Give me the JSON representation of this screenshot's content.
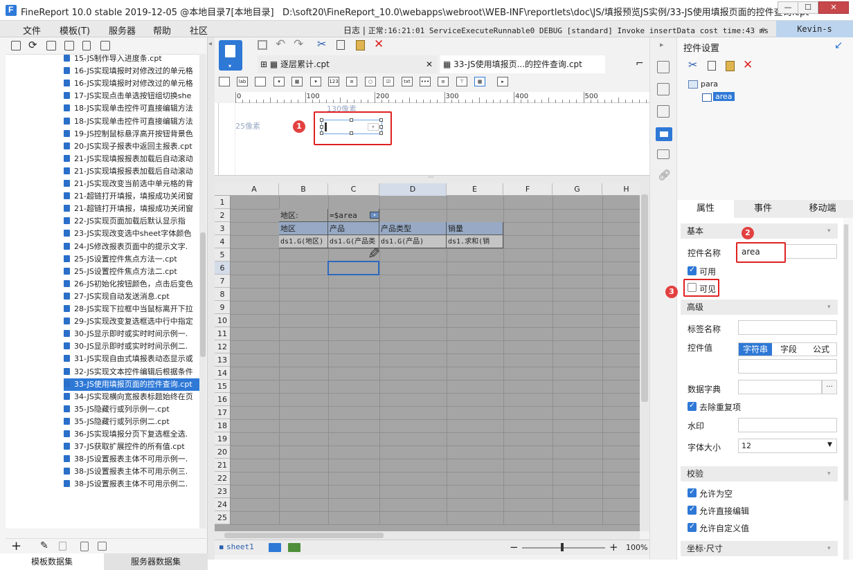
{
  "window": {
    "title": "FineReport 10.0 stable 2019-12-05 @本地目录7[本地目录]",
    "path": "D:\\soft20\\FineReport_10.0\\webapps\\webroot\\WEB-INF\\reportlets\\doc\\JS/填报预览JS实例/33-JS使用填报页面的控件查询.cpt",
    "minimize": "—",
    "maximize": "☐",
    "close": "✕"
  },
  "menu": {
    "items": [
      "文件",
      "模板(T)",
      "服务器",
      "帮助",
      "社区"
    ],
    "log_label": "日志",
    "log_text": "正常:16:21:01 ServiceExecuteRunnable0 DEBUG [standard] Invoke insertData cost time:43 ms",
    "user": "Kevin-s"
  },
  "tree": {
    "items": [
      "15-JS制作导入进度条.cpt",
      "16-JS实现填报时对修改过的单元格",
      "16-JS实现填报时对修改过的单元格",
      "17-JS实现点击单选按钮组切换she",
      "18-JS实现单击控件可直接编辑方法",
      "18-JS实现单击控件可直接编辑方法",
      "19-JS控制鼠标悬浮高开按钮背景色",
      "20-JS实现子报表中返回主报表.cpt",
      "21-JS实现填报报表加载后自动滚动",
      "21-JS实现填报报表加载后自动滚动",
      "21-JS实现改变当前选中单元格的背",
      "21-超链打开填报，填报成功关闭窗",
      "21-超链打开填报，填报成功关闭窗",
      "22-JS实现页面加载后默认显示指",
      "23-JS实现改变选中sheet字体颜色",
      "24-JS修改报表页面中的提示文字.",
      "25-JS设置控件焦点方法一.cpt",
      "25-JS设置控件焦点方法二.cpt",
      "26-JS初始化按钮颜色，点击后变色",
      "27-JS实现自动发送消息.cpt",
      "28-JS实现下拉框中当鼠标离开下拉",
      "29-JS实现改变复选框选中行中指定",
      "30-JS显示即时或实时时间示例一.",
      "30-JS显示即时或实时时间示例二.",
      "31-JS实现自由式填报表动态显示或",
      "32-JS实现文本控件编辑后根据条件",
      "33-JS使用填报页面的控件查询.cpt",
      "34-JS实现横向宽报表标题始终在页",
      "35-JS隐藏行或列示例一.cpt",
      "35-JS隐藏行或列示例二.cpt",
      "36-JS实现填报分页下复选框全选.",
      "37-JS获取扩展控件的所有值.cpt",
      "38-JS设置报表主体不可用示例一.",
      "38-JS设置报表主体不可用示例三.",
      "38-JS设置报表主体不可用示例二."
    ],
    "selected_index": 26
  },
  "left_tabs": [
    "模板数据集",
    "服务器数据集"
  ],
  "doc_tabs": [
    "逐层累计.cpt",
    "33-JS使用填报页...的控件查询.cpt"
  ],
  "ruler": {
    "ticks": [
      "0",
      "100",
      "200",
      "300",
      "400",
      "500"
    ]
  },
  "param": {
    "width_hint": "130像素",
    "height_hint": "25像素",
    "badge": "1"
  },
  "sheet": {
    "columns": [
      "A",
      "B",
      "C",
      "D",
      "E",
      "F",
      "G",
      "H"
    ],
    "rows": [
      "1",
      "2",
      "3",
      "4",
      "5",
      "6",
      "7",
      "8",
      "9",
      "10",
      "11",
      "12",
      "13",
      "14",
      "15",
      "16",
      "17",
      "18",
      "19",
      "20",
      "21",
      "22",
      "23",
      "24",
      "25"
    ],
    "b2": "地区:",
    "c2": "=$area",
    "headers": [
      "地区",
      "产品",
      "产品类型",
      "销量"
    ],
    "row4": [
      "ds1.G(地区)",
      "ds1.G(产品类",
      "ds1.G(产品)",
      "ds1.求和(销"
    ],
    "tab": "sheet1",
    "zoom": "100%"
  },
  "right": {
    "title": "控件设置",
    "tree": [
      "para",
      "area"
    ],
    "tabs": [
      "属性",
      "事件",
      "移动端"
    ],
    "basic": "基本",
    "name_label": "控件名称",
    "name_value": "area",
    "enabled": "可用",
    "visible": "可见",
    "advanced": "高级",
    "label_name": "标签名称",
    "value_label": "控件值",
    "value_modes": [
      "字符串",
      "字段",
      "公式"
    ],
    "dict": "数据字典",
    "dict_btn": "···",
    "dedupe": "去除重复项",
    "watermark": "水印",
    "font_size": "字体大小",
    "font_size_value": "12",
    "validate": "校验",
    "allow_empty": "允许为空",
    "allow_edit": "允许直接编辑",
    "allow_custom": "允许自定义值",
    "coords": "坐标·尺寸",
    "badge2": "2",
    "badge3": "3"
  }
}
